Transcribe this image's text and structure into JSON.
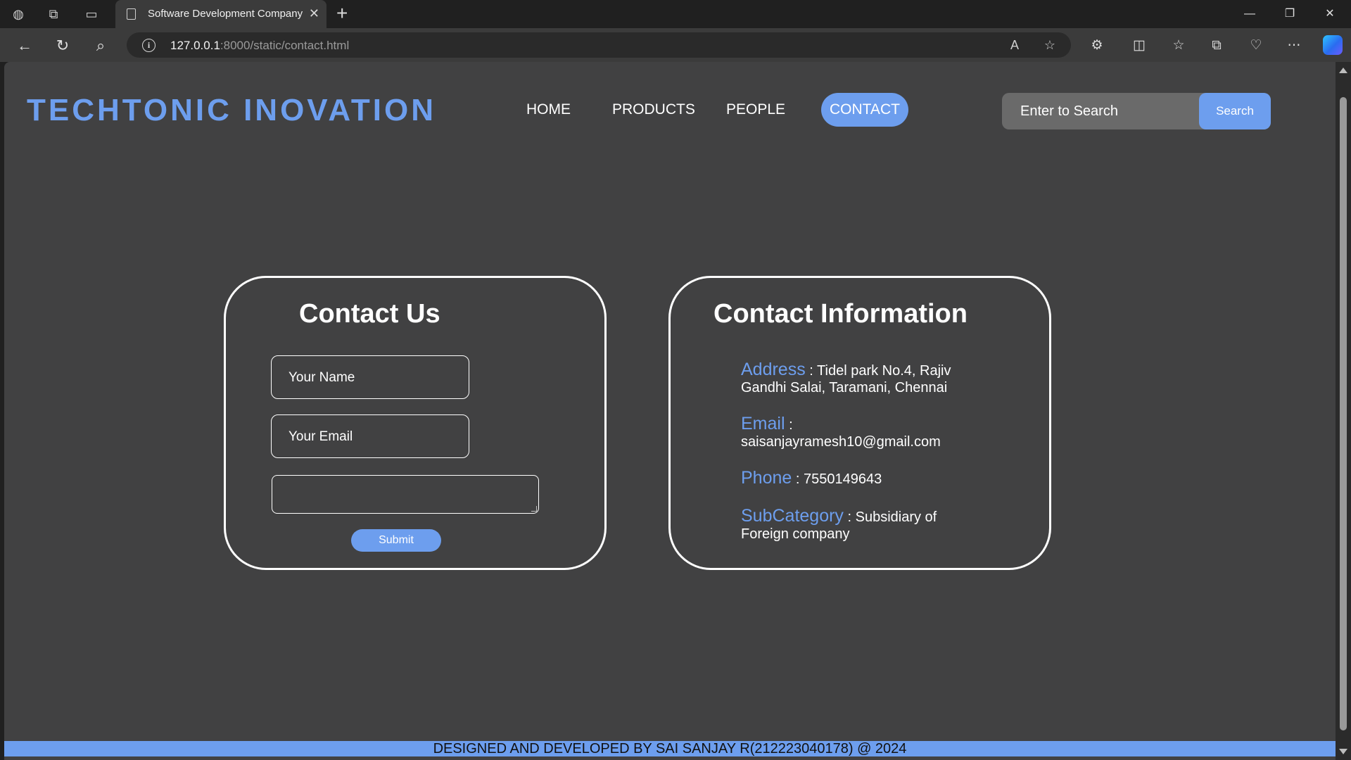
{
  "browser": {
    "tab_title": "Software Development Company",
    "url_host": "127.0.0.1",
    "url_rest": ":8000/static/contact.html"
  },
  "site": {
    "logo": "TECHTONIC INOVATION",
    "nav": {
      "home": "HOME",
      "products": "PRODUCTS",
      "people": "PEOPLE",
      "contact": "CONTACT"
    },
    "search": {
      "placeholder": "Enter to Search",
      "button": "Search"
    }
  },
  "contact_form": {
    "title": "Contact Us",
    "name_placeholder": "Your Name",
    "email_placeholder": "Your Email",
    "message_value": "",
    "submit": "Submit"
  },
  "contact_info": {
    "title": "Contact Information",
    "items": [
      {
        "label": "Address",
        "sep": " : ",
        "value": "Tidel park No.4, Rajiv Gandhi Salai, Taramani, Chennai"
      },
      {
        "label": "Email",
        "sep": " : ",
        "value": "saisanjayramesh10@gmail.com"
      },
      {
        "label": "Phone",
        "sep": " : ",
        "value": "7550149643"
      },
      {
        "label": "SubCategory",
        "sep": " : ",
        "value": "Subsidiary of Foreign company"
      }
    ]
  },
  "footer": "DESIGNED AND DEVELOPED BY SAI SANJAY R(212223040178) @ 2024",
  "colors": {
    "accent": "#6d9eee",
    "page_bg": "#414142",
    "text": "#ffffff"
  }
}
